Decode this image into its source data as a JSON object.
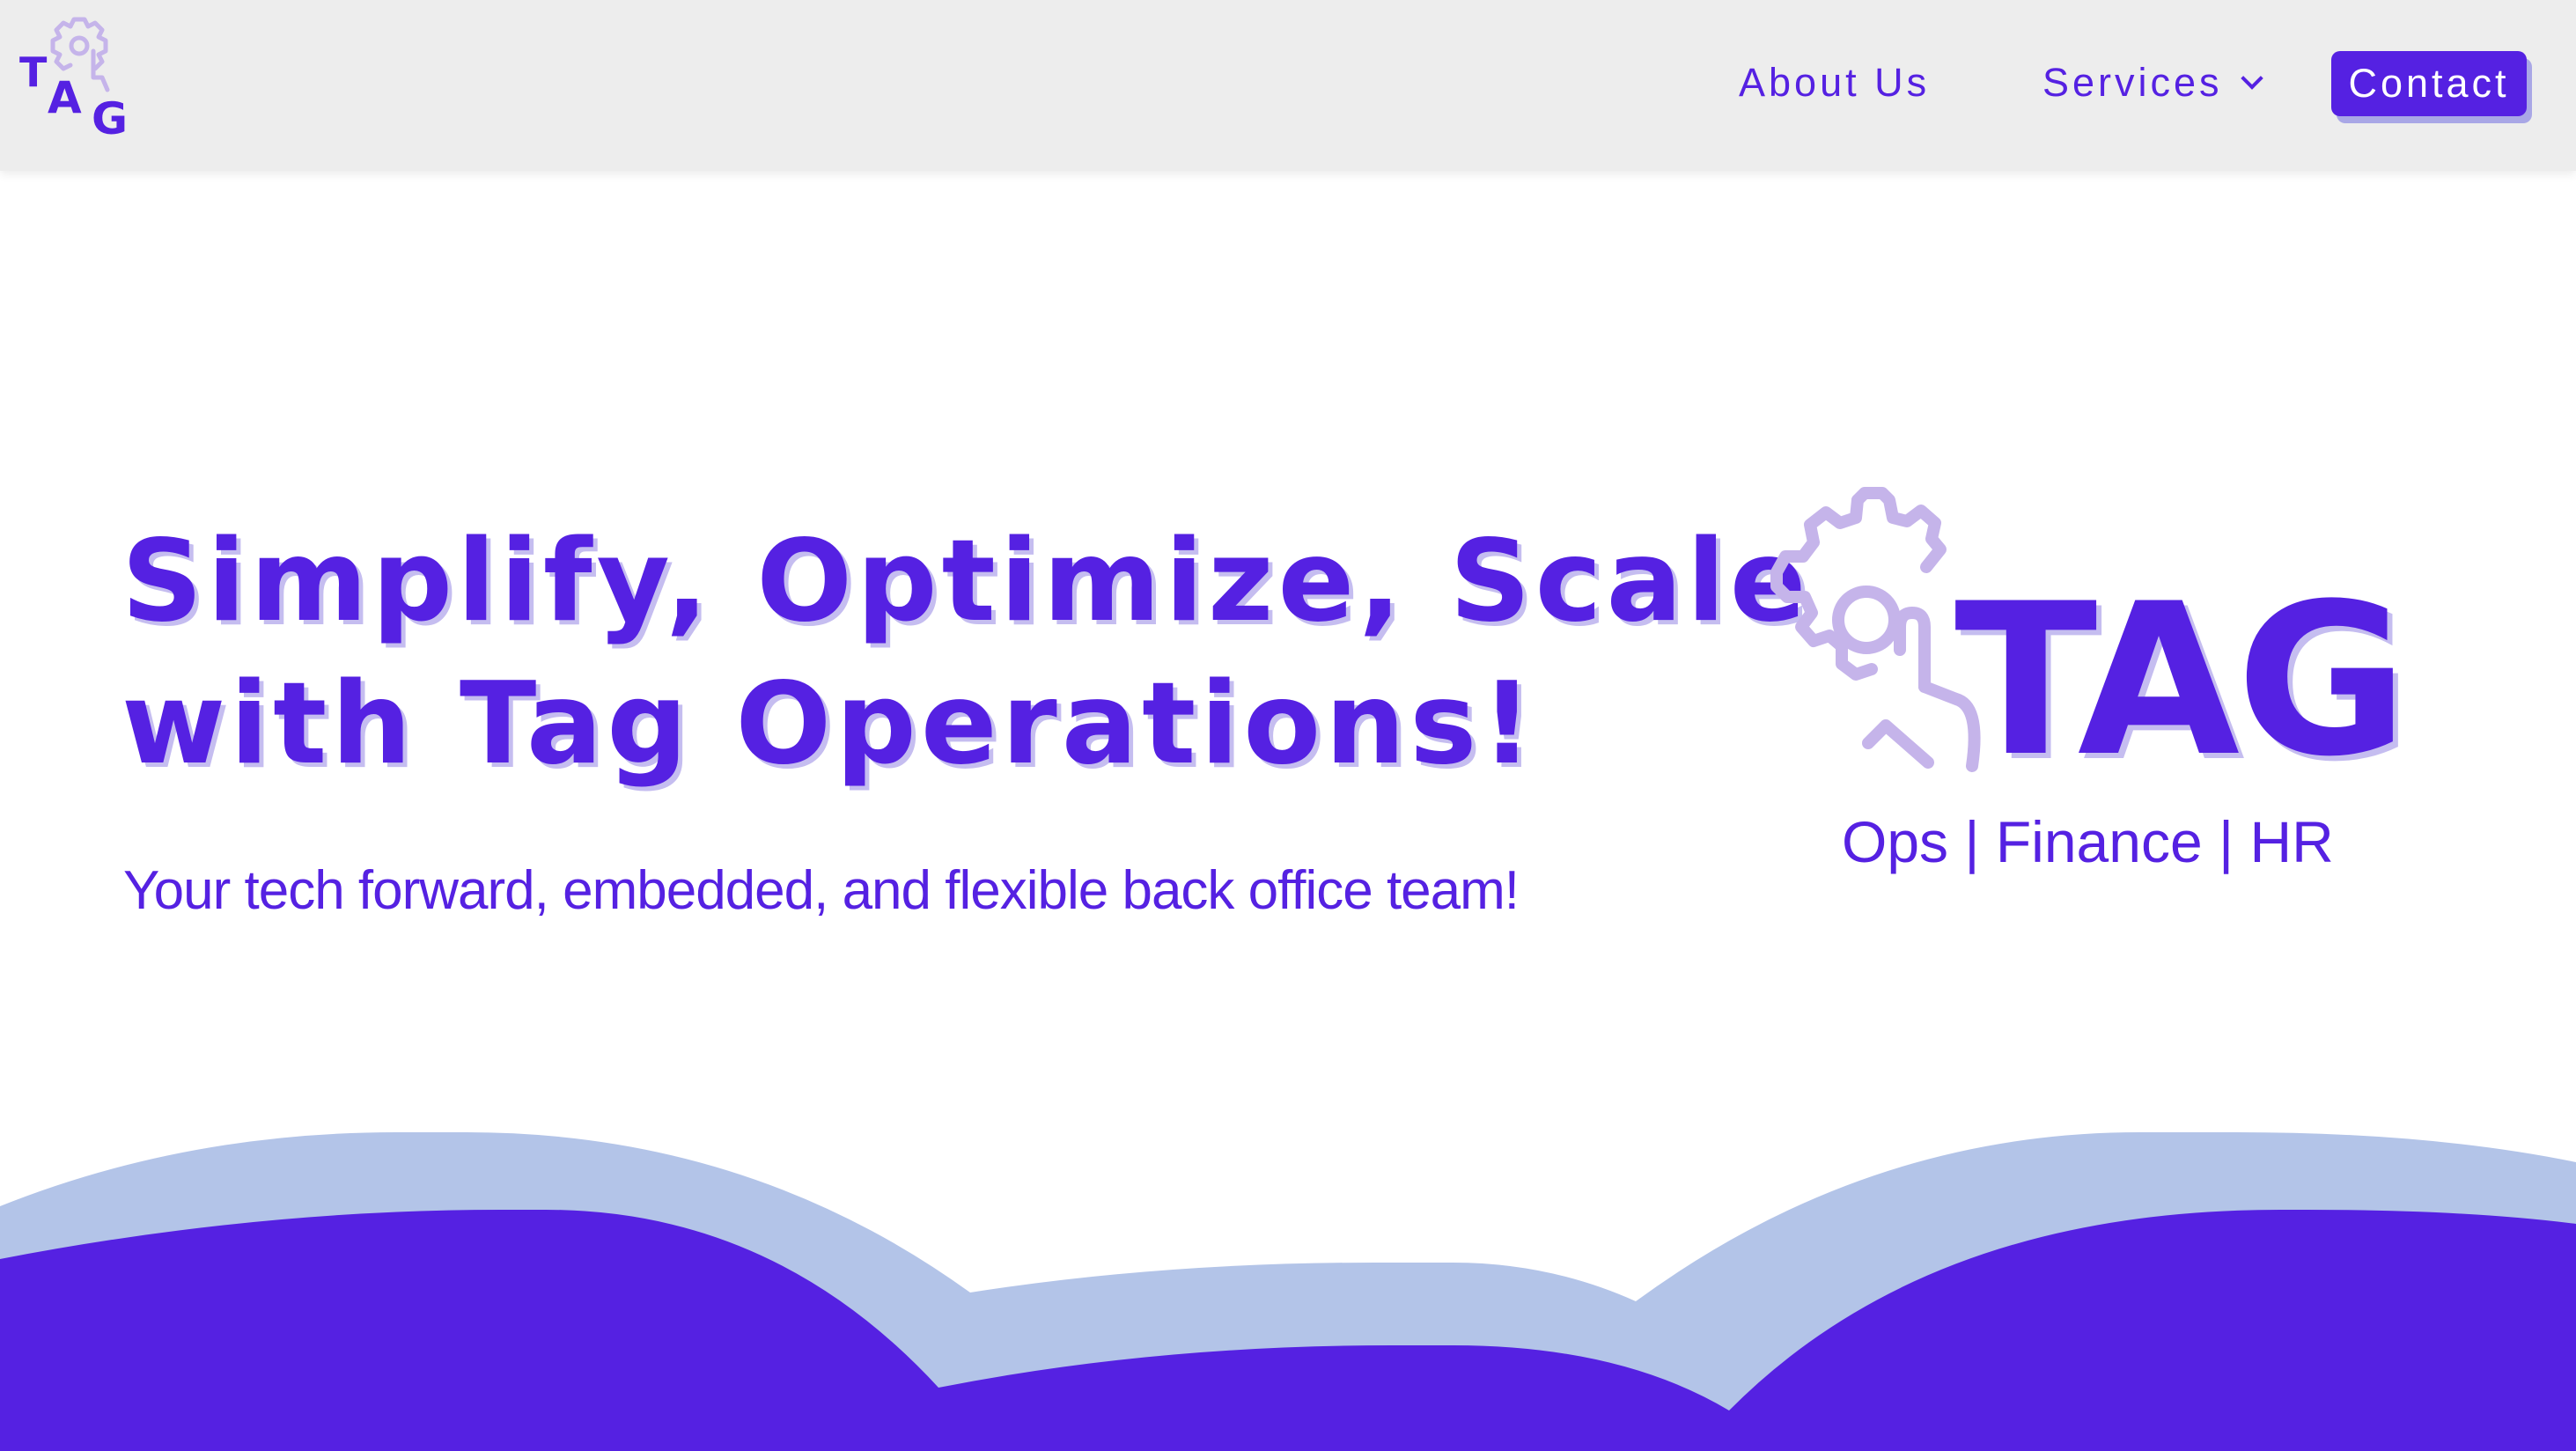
{
  "header": {
    "logo_text": "TAG",
    "nav": {
      "about_label": "About Us",
      "services_label": "Services",
      "contact_label": "Contact"
    }
  },
  "hero": {
    "title_line1": "Simplify, Optimize, Scale",
    "title_line2": "with Tag Operations!",
    "subtitle": "Your tech forward, embedded, and flexible back office team!"
  },
  "brand_logo": {
    "wordmark": "TAG",
    "tagline": "Ops | Finance | HR"
  },
  "colors": {
    "accent": "#5521e2",
    "header_bg": "#ededed",
    "wave_light": "#b3c4e8",
    "gear_light": "#c5b4ea"
  },
  "icons": {
    "header_logo": "tag-gear-logo-icon",
    "services_dropdown": "chevron-down-icon",
    "brand_gear": "gear-icon"
  }
}
